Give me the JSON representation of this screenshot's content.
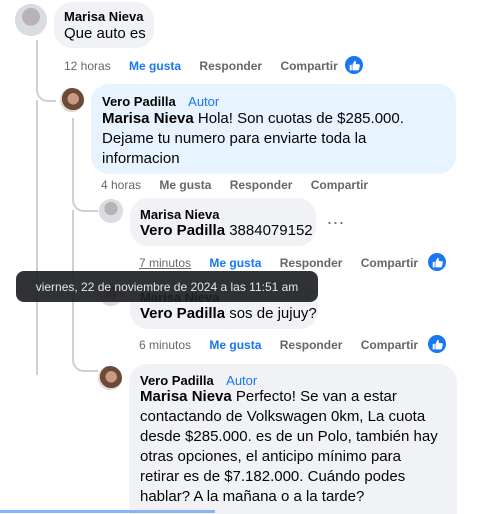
{
  "comments": [
    {
      "name": "Marisa Nieva",
      "text": "Que auto es",
      "time": "12 horas"
    },
    {
      "name": "Vero Padilla",
      "badge": "Autor",
      "mention": "Marisa Nieva",
      "lines": [
        " Hola! Son cuotas de $285.000.",
        "Dejame tu numero para enviarte toda la",
        "informacion"
      ],
      "time": "4 horas"
    },
    {
      "name": "Marisa Nieva",
      "mention": "Vero Padilla",
      "text": " 3884079152",
      "time": "7 minutos",
      "more": "..."
    },
    {
      "name": "Marisa Nieva",
      "mention": "Vero Padilla",
      "text": " sos de jujuy?",
      "time": "6 minutos"
    },
    {
      "name": "Vero Padilla",
      "badge": "Autor",
      "mention": "Marisa Nieva",
      "lines": [
        " Perfecto! Se van a estar",
        "contactando de Volkswagen 0km, La cuota",
        "desde $285.000. es de un Polo, también hay",
        "otras opciones, el anticipo mínimo para",
        "retirar es de $7.182.000. Cuándo podes",
        "hablar? A la mañana o a la tarde?"
      ]
    }
  ],
  "actions": {
    "like": "Me gusta",
    "reply": "Responder",
    "share": "Compartir"
  },
  "tooltip": "viernes, 22 de noviembre de 2024 a las 11:51 am",
  "icons": {
    "like": "thumbs-up-icon",
    "more": "more-options-icon"
  },
  "colors": {
    "accent": "#1877f2",
    "bubble": "#f0f2f5",
    "author_bubble": "#e7f3ff",
    "muted": "#65676b"
  }
}
